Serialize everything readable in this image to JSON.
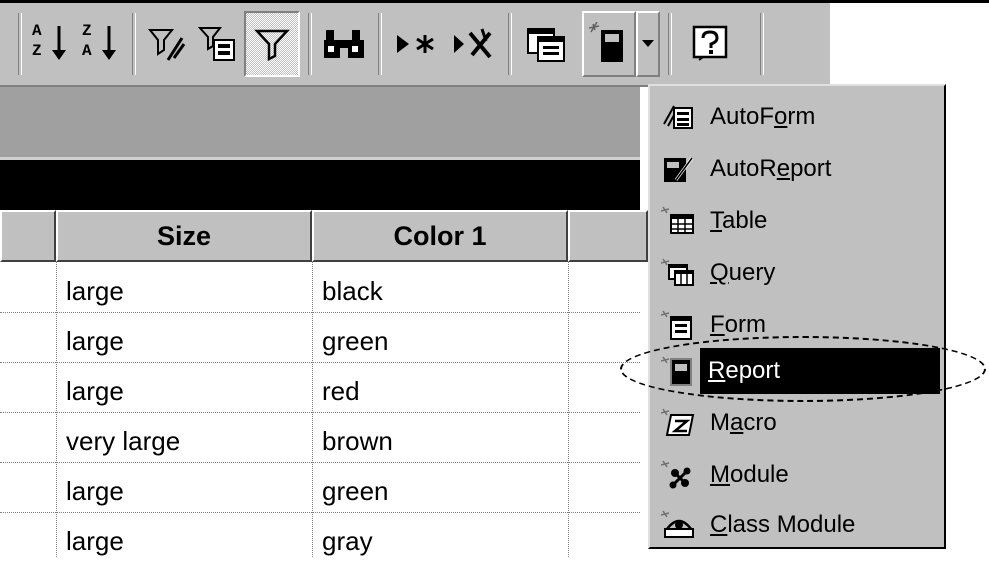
{
  "toolbar": {
    "buttons": [
      {
        "icon": "sort-ascending-icon"
      },
      {
        "icon": "sort-descending-icon"
      },
      {
        "icon": "filter-by-selection-icon"
      },
      {
        "icon": "filter-by-form-icon"
      },
      {
        "icon": "apply-filter-icon"
      },
      {
        "icon": "find-icon"
      },
      {
        "icon": "new-record-icon"
      },
      {
        "icon": "delete-record-icon"
      },
      {
        "icon": "database-window-icon"
      },
      {
        "icon": "new-object-icon"
      },
      {
        "icon": "help-icon"
      }
    ],
    "sort_asc_top": "A",
    "sort_asc_bottom": "Z",
    "sort_desc_top": "Z",
    "sort_desc_bottom": "A"
  },
  "table": {
    "columns": [
      "Size",
      "Color 1"
    ],
    "rows": [
      [
        "large",
        "black"
      ],
      [
        "large",
        "green"
      ],
      [
        "large",
        "red"
      ],
      [
        "very large",
        "brown"
      ],
      [
        "large",
        "green"
      ],
      [
        "large",
        "gray"
      ]
    ]
  },
  "menu": {
    "items": [
      {
        "icon": "autoform-icon",
        "pre": "AutoF",
        "accel": "o",
        "post": "rm"
      },
      {
        "icon": "autoreport-icon",
        "pre": "AutoR",
        "accel": "e",
        "post": "port"
      },
      {
        "icon": "table-icon",
        "pre": "",
        "accel": "T",
        "post": "able"
      },
      {
        "icon": "query-icon",
        "pre": "",
        "accel": "Q",
        "post": "uery"
      },
      {
        "icon": "form-icon",
        "pre": "",
        "accel": "F",
        "post": "orm"
      },
      {
        "icon": "report-icon",
        "pre": "",
        "accel": "R",
        "post": "eport",
        "selected": true
      },
      {
        "icon": "macro-icon",
        "pre": "M",
        "accel": "a",
        "post": "cro"
      },
      {
        "icon": "module-icon",
        "pre": "",
        "accel": "M",
        "post": "odule"
      },
      {
        "icon": "class-module-icon",
        "pre": "",
        "accel": "C",
        "post": "lass Module"
      }
    ]
  },
  "colors": {
    "toolbar_bg": "#c0c0c0",
    "selection_bg": "#000000",
    "selection_text": "#ffffff"
  }
}
